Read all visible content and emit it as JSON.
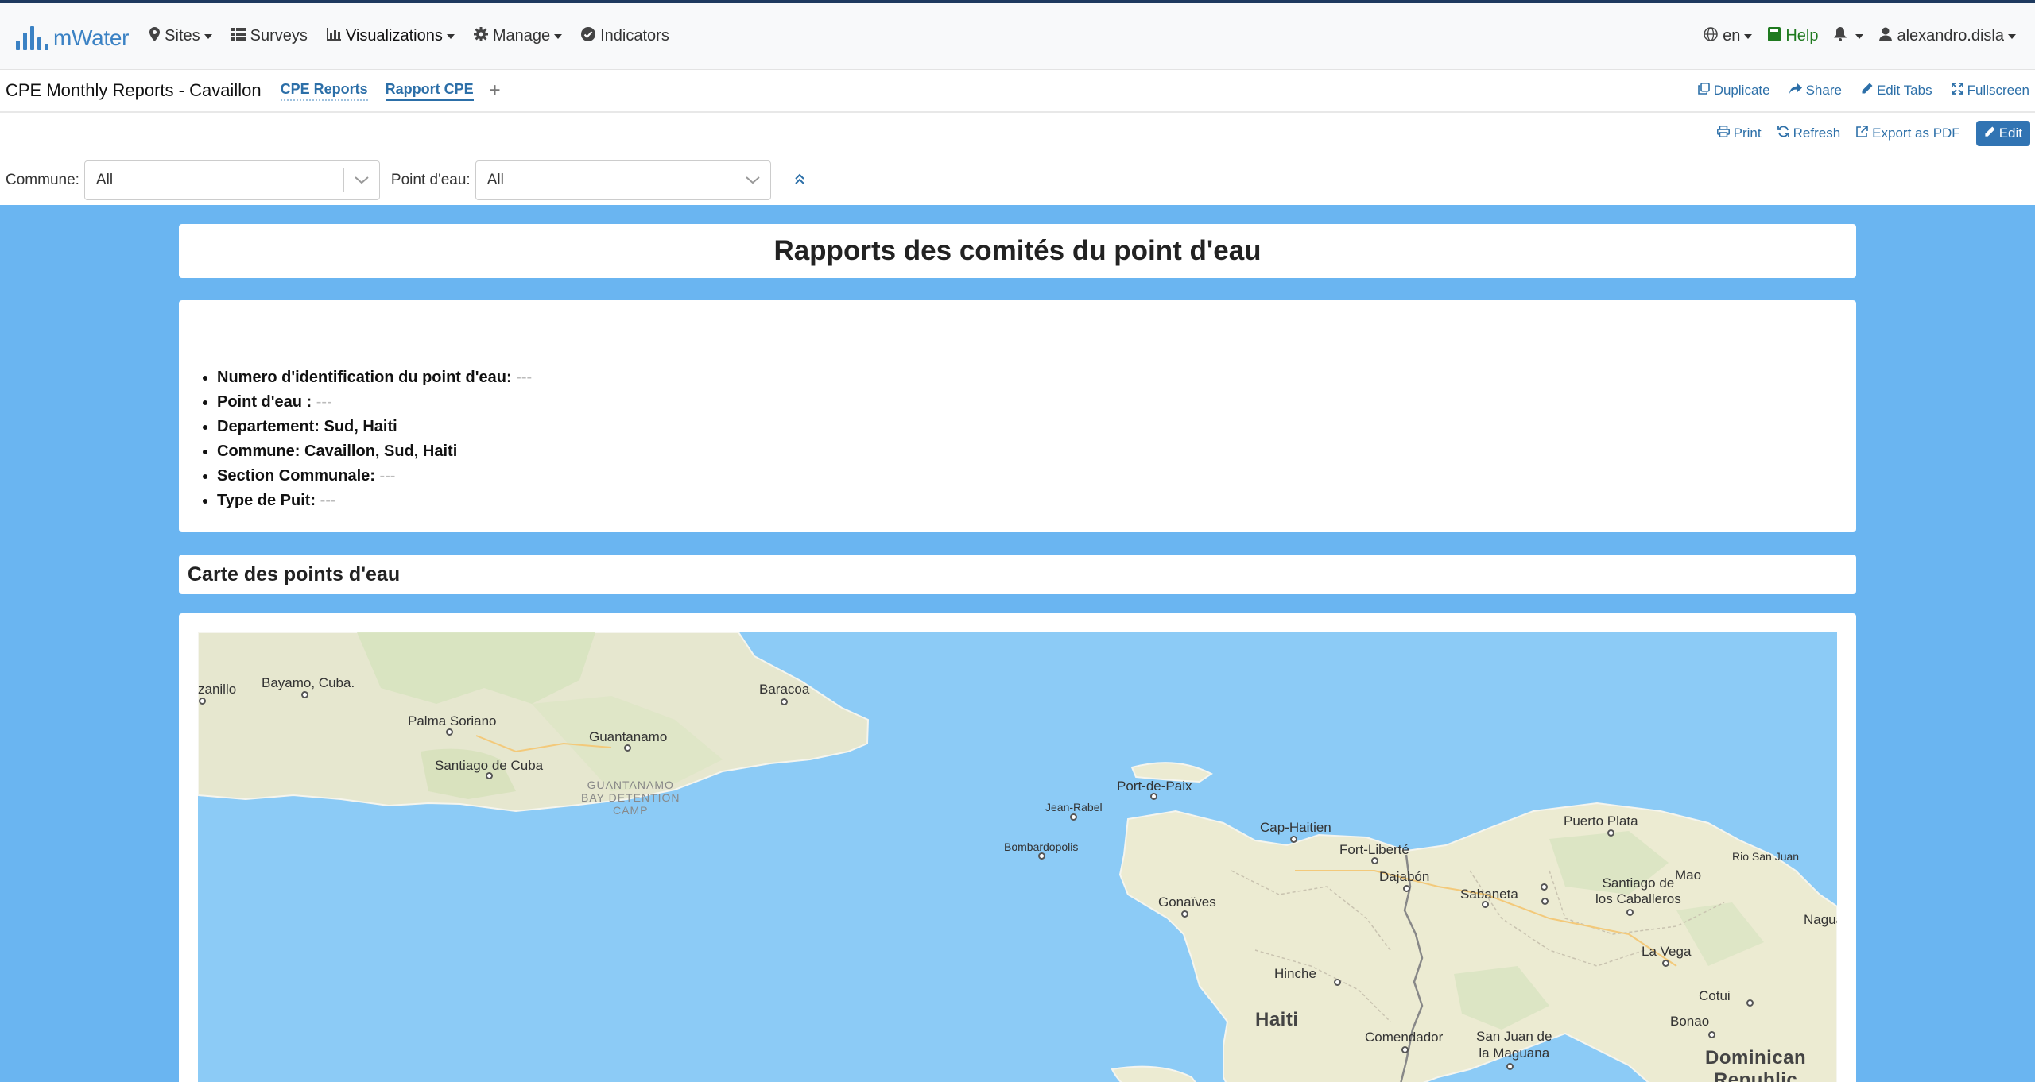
{
  "brand": {
    "name": "mWater"
  },
  "nav": {
    "left": [
      {
        "label": "Sites",
        "icon": "map-marker-icon",
        "dropdown": true
      },
      {
        "label": "Surveys",
        "icon": "list-icon",
        "dropdown": false
      },
      {
        "label": "Visualizations",
        "icon": "bar-chart-icon",
        "dropdown": true
      },
      {
        "label": "Manage",
        "icon": "gear-icon",
        "dropdown": true
      },
      {
        "label": "Indicators",
        "icon": "check-circle-icon",
        "dropdown": false
      }
    ],
    "language": "en",
    "help": "Help",
    "user": "alexandro.disla"
  },
  "dashboard": {
    "title": "CPE Monthly Reports - Cavaillon",
    "tabs": [
      {
        "label": "CPE Reports"
      },
      {
        "label": "Rapport CPE",
        "active": true
      }
    ],
    "tab_add": "+",
    "actions": {
      "duplicate": "Duplicate",
      "share": "Share",
      "edit_tabs": "Edit Tabs",
      "fullscreen": "Fullscreen"
    },
    "actions2": {
      "print": "Print",
      "refresh": "Refresh",
      "export_pdf": "Export as PDF",
      "edit": "Edit"
    }
  },
  "filters": {
    "commune": {
      "label": "Commune:",
      "value": "All"
    },
    "point_eau": {
      "label": "Point d'eau:",
      "value": "All"
    }
  },
  "report": {
    "title": "Rapports des comités du point d'eau",
    "items": [
      {
        "label": "Numero d'identification du point d'eau:",
        "value": "---"
      },
      {
        "label": "Point d'eau :",
        "value": "---"
      },
      {
        "label": "Departement: Sud, Haiti",
        "value": ""
      },
      {
        "label": "Commune: Cavaillon, Sud, Haiti",
        "value": ""
      },
      {
        "label": "Section Communale:",
        "value": "---"
      },
      {
        "label": "Type de Puit:",
        "value": "---"
      }
    ],
    "map_section_title": "Carte des points d'eau"
  },
  "map": {
    "places": {
      "manzanillo": "zanillo",
      "bayamo": "Bayamo, Cuba.",
      "baracoa": "Baracoa",
      "palma_soriano": "Palma Soriano",
      "guantanamo": "Guantanamo",
      "santiago_de_cuba": "Santiago de Cuba",
      "guantanamo_bay_1": "GUANTANAMO",
      "guantanamo_bay_2": "BAY DETENTION",
      "guantanamo_bay_3": "CAMP",
      "port_de_paix": "Port-de-Paix",
      "jean_rabel": "Jean-Rabel",
      "cap_haitien": "Cap-Haitien",
      "bombardopolis": "Bombardopolis",
      "fort_liberte": "Fort-Liberté",
      "puerto_plata": "Puerto Plata",
      "rio_san_juan": "Rio San Juan",
      "dajabon": "Dajabón",
      "mao": "Mao",
      "sabaneta": "Sabaneta",
      "santiago_de_1": "Santiago de",
      "santiago_de_2": "los Caballeros",
      "gonaives": "Gonaïves",
      "nagua": "Nagua",
      "la_vega": "La Vega",
      "hinche": "Hinche",
      "cotui": "Cotui",
      "haiti": "Haiti",
      "bonao": "Bonao",
      "comendador": "Comendador",
      "san_juan_1": "San Juan de",
      "san_juan_2": "la Maguana",
      "dominican_1": "Dominican",
      "dominican_2": "Republic"
    }
  }
}
